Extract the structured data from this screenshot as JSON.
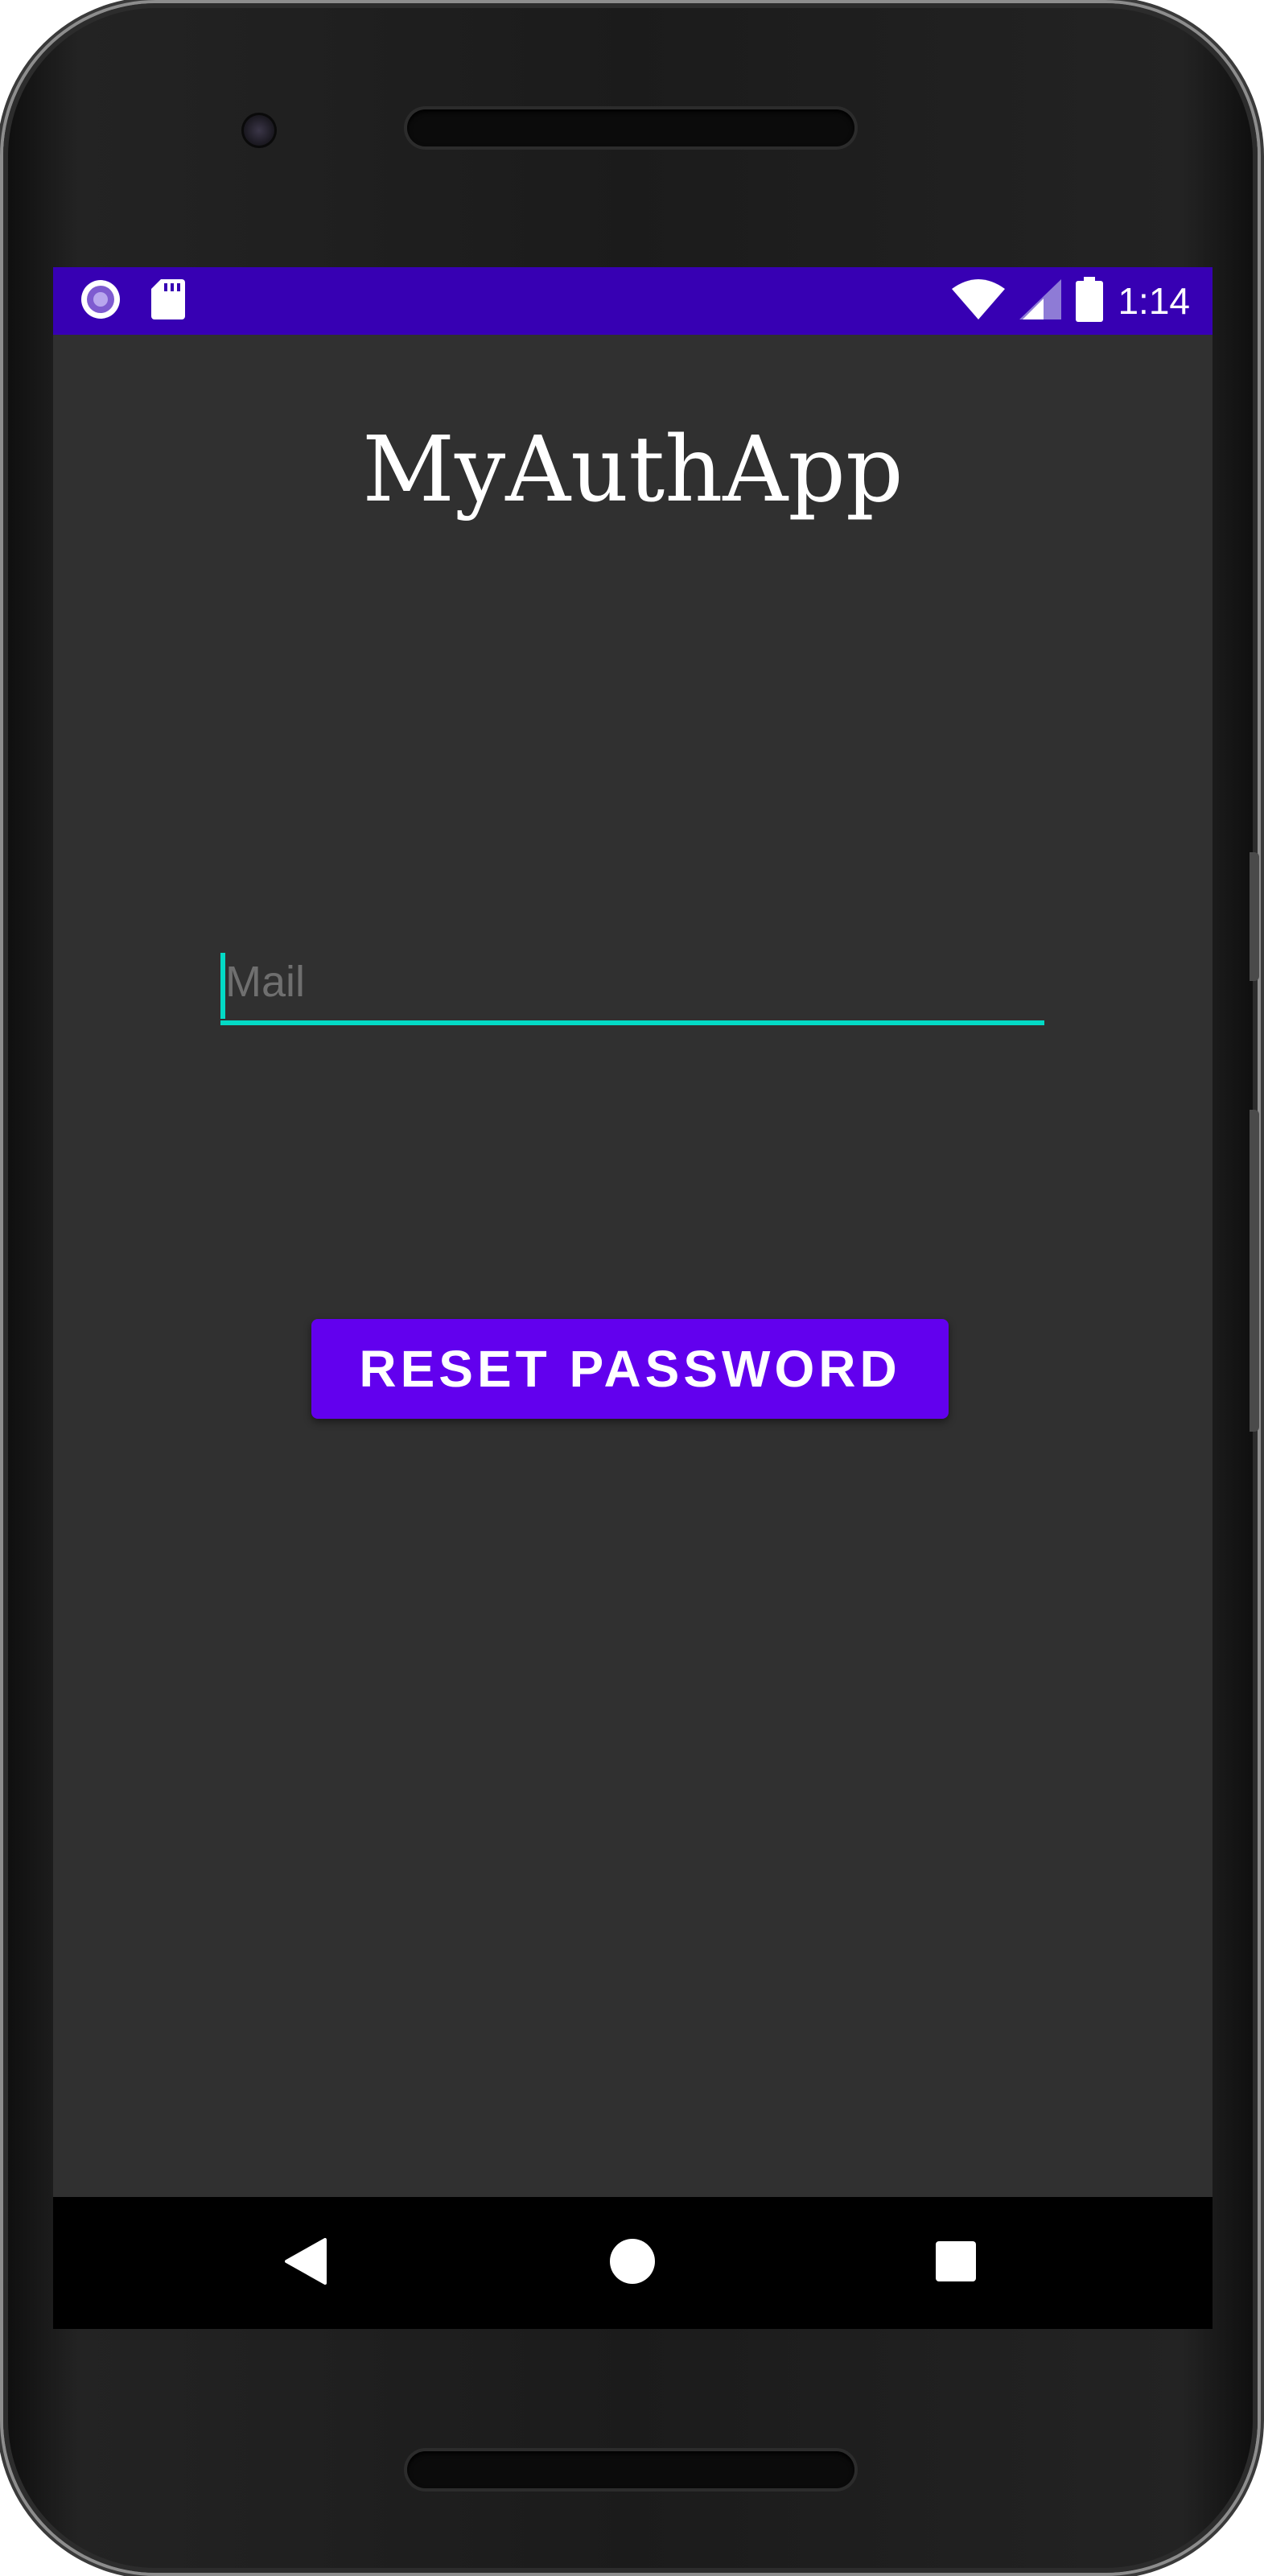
{
  "status_bar": {
    "time": "1:14",
    "left_icons": [
      "cast-circle-icon",
      "sd-card-icon"
    ],
    "right_icons": [
      "wifi-icon",
      "cellular-signal-icon",
      "battery-icon"
    ],
    "color": "#3700b3"
  },
  "app": {
    "title": "MyAuthApp",
    "background_color": "#303030"
  },
  "mail_field": {
    "placeholder": "Mail",
    "value": "",
    "accent_color": "#03dac5"
  },
  "reset_button": {
    "label": "RESET PASSWORD",
    "color": "#6200ee"
  },
  "nav_bar": {
    "buttons": [
      "back-icon",
      "home-icon",
      "recents-icon"
    ]
  }
}
